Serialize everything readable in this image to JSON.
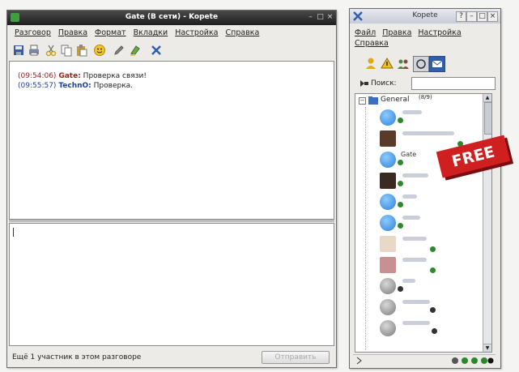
{
  "chat_window": {
    "title": "Gate (В сети) - Kopete",
    "menu": [
      "Разговор",
      "Правка",
      "Формат",
      "Вкладки",
      "Настройка",
      "Справка"
    ],
    "messages": [
      {
        "time": "(09:54:06)",
        "name": "Gate:",
        "text": "Проверка связи!"
      },
      {
        "time": "(09:55:57)",
        "name": "TechnO:",
        "text": "Проверка."
      }
    ],
    "status": "Ещё 1 участник в этом разговоре",
    "send_label": "Отправить"
  },
  "contact_window": {
    "title": "Kopete",
    "menu": [
      "Файл",
      "Правка",
      "Настройка",
      "Справка"
    ],
    "search_label": "Поиск:",
    "search_value": "",
    "group_label": "General",
    "group_count": "(8/9)",
    "visible_contact": "Gate"
  },
  "badge": {
    "label": "FREE",
    "color": "#d01f1f"
  },
  "colors": {
    "titlebar": "#2a2a2a",
    "online": "#2a8a2a",
    "offline": "#333333",
    "selection": "#2f5db0"
  }
}
